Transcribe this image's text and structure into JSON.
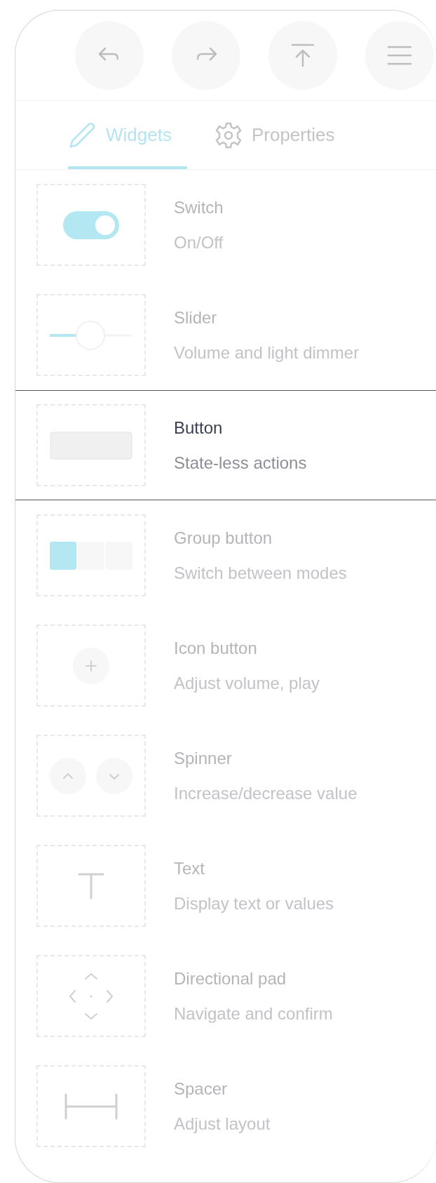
{
  "toolbar": [
    {
      "kind": "undo"
    },
    {
      "kind": "redo"
    },
    {
      "kind": "upload"
    },
    {
      "kind": "menu"
    }
  ],
  "tabs": [
    {
      "kind": "pencil",
      "label": "Widgets",
      "selected": true
    },
    {
      "kind": "gear",
      "label": "Properties",
      "selected": false
    }
  ],
  "widgets": [
    {
      "kind": "switch",
      "title": "Switch",
      "description": "On/Off",
      "selected": false
    },
    {
      "kind": "slider",
      "title": "Slider",
      "description": "Volume and light dimmer",
      "selected": false
    },
    {
      "kind": "button",
      "title": "Button",
      "description": "State-less actions",
      "selected": true
    },
    {
      "kind": "group",
      "title": "Group button",
      "description": "Switch between modes",
      "selected": false
    },
    {
      "kind": "iconbutton",
      "title": "Icon button",
      "description": "Adjust volume, play",
      "selected": false
    },
    {
      "kind": "spinner",
      "title": "Spinner",
      "description": "Increase/decrease value",
      "selected": false
    },
    {
      "kind": "text",
      "title": "Text",
      "description": "Display text or values",
      "selected": false
    },
    {
      "kind": "dpad",
      "title": "Directional pad",
      "description": "Navigate and confirm",
      "selected": false
    },
    {
      "kind": "spacer",
      "title": "Spacer",
      "description": "Adjust layout",
      "selected": false
    }
  ]
}
